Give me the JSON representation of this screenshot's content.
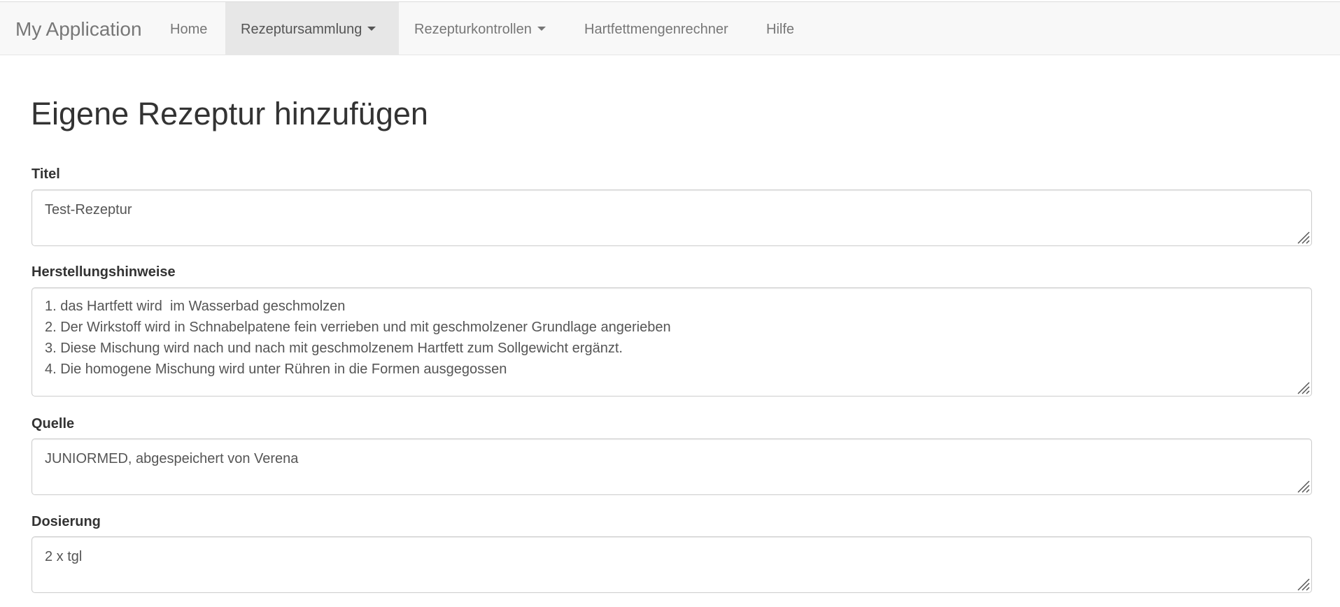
{
  "navbar": {
    "brand": "My Application",
    "items": [
      {
        "label": "Home",
        "dropdown": false,
        "active": false
      },
      {
        "label": "Rezeptursammlung",
        "dropdown": true,
        "active": true
      },
      {
        "label": "Rezepturkontrollen",
        "dropdown": true,
        "active": false
      },
      {
        "label": "Hartfettmengenrechner",
        "dropdown": false,
        "active": false
      },
      {
        "label": "Hilfe",
        "dropdown": false,
        "active": false
      }
    ]
  },
  "page": {
    "title": "Eigene Rezeptur hinzufügen"
  },
  "form": {
    "titel": {
      "label": "Titel",
      "value": "Test-Rezeptur"
    },
    "herstellungshinweise": {
      "label": "Herstellungshinweise",
      "lines": [
        "1. das Hartfett wird  im Wasserbad geschmolzen",
        "2. Der Wirkstoff wird in Schnabelpatene fein verrieben und mit geschmolzener Grundlage angerieben",
        "3. Diese Mischung wird nach und nach mit geschmolzenem Hartfett zum Sollgewicht ergänzt.",
        "4. Die homogene Mischung wird unter Rühren in die Formen ausgegossen"
      ]
    },
    "quelle": {
      "label": "Quelle",
      "value": "JUNIORMED, abgespeichert von Verena"
    },
    "dosierung": {
      "label": "Dosierung",
      "value": "2 x tgl"
    }
  },
  "colors": {
    "navbar_bg": "#f8f8f8",
    "nav_active_bg": "#e7e7e7",
    "nav_text": "#777777",
    "field_border": "#cccccc",
    "text": "#333333"
  },
  "icons": {
    "dropdown": "caret-down-icon",
    "resize": "resize-grip-icon"
  }
}
